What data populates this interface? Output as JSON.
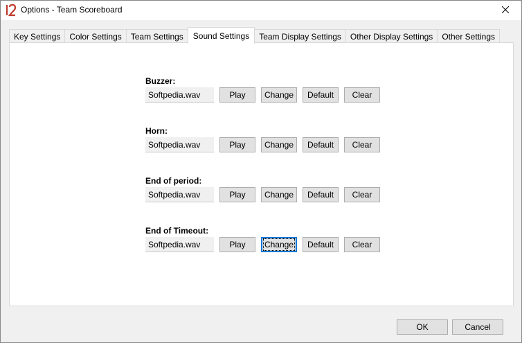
{
  "window": {
    "title": "Options - Team Scoreboard",
    "icon": "scoreboard-logo-icon",
    "accent_color": "#c0392b"
  },
  "tabs": [
    {
      "label": "Key Settings",
      "active": false
    },
    {
      "label": "Color Settings",
      "active": false
    },
    {
      "label": "Team Settings",
      "active": false
    },
    {
      "label": "Sound Settings",
      "active": true
    },
    {
      "label": "Team Display Settings",
      "active": false
    },
    {
      "label": "Other Display Settings",
      "active": false
    },
    {
      "label": "Other Settings",
      "active": false
    }
  ],
  "sounds": [
    {
      "label": "Buzzer:",
      "file": "Softpedia.wav"
    },
    {
      "label": "Horn:",
      "file": "Softpedia.wav"
    },
    {
      "label": "End of period:",
      "file": "Softpedia.wav"
    },
    {
      "label": "End of Timeout:",
      "file": "Softpedia.wav"
    }
  ],
  "sound_buttons": {
    "play": "Play",
    "change": "Change",
    "default": "Default",
    "clear": "Clear"
  },
  "focused": {
    "group": "End of Timeout:",
    "button": "Change"
  },
  "dialog": {
    "ok": "OK",
    "cancel": "Cancel"
  }
}
